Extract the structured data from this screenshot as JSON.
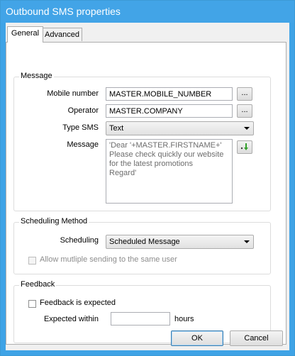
{
  "window": {
    "title": "Outbound SMS properties"
  },
  "tabs": [
    {
      "label": "General",
      "active": true
    },
    {
      "label": "Advanced",
      "active": false
    }
  ],
  "message_group": {
    "title": "Message",
    "mobile_label": "Mobile number",
    "mobile_value": "MASTER.MOBILE_NUMBER",
    "operator_label": "Operator",
    "operator_value": "MASTER.COMPANY",
    "browse_label": "...",
    "type_label": "Type SMS",
    "type_value": "Text",
    "message_label": "Message",
    "message_value": "'Dear '+MASTER.FIRSTNAME+'\nPlease check quickly our website\nfor the latest promotions\nRegard'",
    "insert_icon": "green-arrow-insert-icon"
  },
  "scheduling_group": {
    "title": "Scheduling Method",
    "scheduling_label": "Scheduling",
    "scheduling_value": "Scheduled Message",
    "allow_multiple_label": "Allow mutliple sending to the same user",
    "allow_multiple_checked": false
  },
  "feedback_group": {
    "title": "Feedback",
    "feedback_label": "Feedback is expected",
    "feedback_checked": false,
    "expected_within_label": "Expected within",
    "expected_within_value": "",
    "hours_label": "hours"
  },
  "buttons": {
    "ok": "OK",
    "cancel": "Cancel"
  },
  "colors": {
    "titlebar": "#42a4e7",
    "client_bg": "#f0f0f0"
  }
}
